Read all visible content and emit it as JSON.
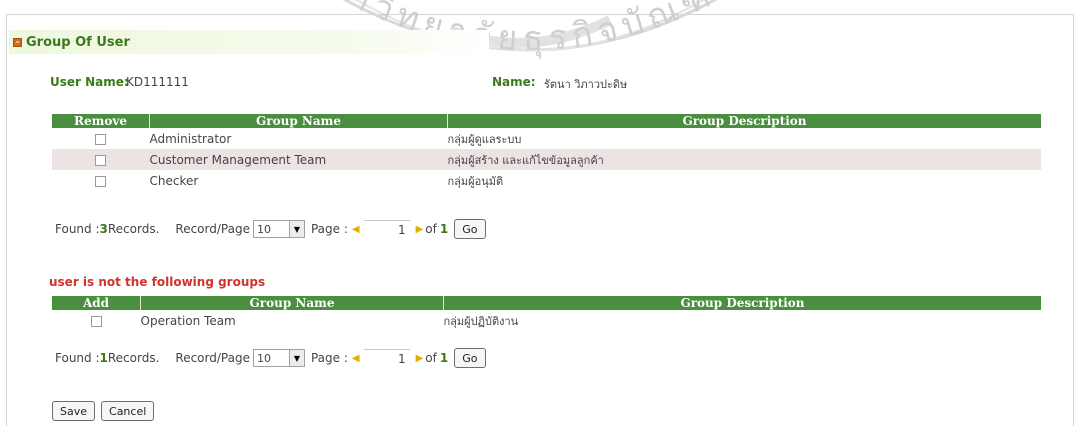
{
  "panel": {
    "title": "Group Of User",
    "toggle_glyph": "–"
  },
  "user": {
    "username_label": "User Name:",
    "username_value": "KD111111",
    "name_label": "Name:",
    "name_value": "รัตนา วิภาวปะดิษ"
  },
  "watermark": {
    "text": "มหาวิทยาลัยธุรกิจบัณฑิตย์"
  },
  "member_groups": {
    "columns": [
      "Remove",
      "Group Name",
      "Group Description"
    ],
    "rows": [
      {
        "name": "Administrator",
        "description": "กลุ่มผู้ดูแลระบบ"
      },
      {
        "name": "Customer Management Team",
        "description": "กลุ่มผู้สร้าง และแก้ไขข้อมูลลูกค้า"
      },
      {
        "name": "Checker",
        "description": "กลุ่มผู้อนุมัติ"
      }
    ],
    "pager": {
      "found_prefix": "Found : ",
      "count": "3",
      "found_suffix": " Records.",
      "record_label": "Record/Page",
      "record_value": "10",
      "page_label": "Page :",
      "page_value": "1",
      "of_label": "of",
      "total_pages": "1",
      "go_label": "Go"
    }
  },
  "nonmember_groups": {
    "title": "user is not the following groups",
    "columns": [
      "Add",
      "Group Name",
      "Group Description"
    ],
    "rows": [
      {
        "name": "Operation Team",
        "description": "กลุ่มผู้ปฏิบัติงาน"
      }
    ],
    "pager": {
      "found_prefix": "Found : ",
      "count": "1",
      "found_suffix": " Records.",
      "record_label": "Record/Page",
      "record_value": "10",
      "page_label": "Page :",
      "page_value": "1",
      "of_label": "of",
      "total_pages": "1",
      "go_label": "Go"
    }
  },
  "actions": {
    "save": "Save",
    "cancel": "Cancel"
  },
  "colors": {
    "header_green": "#4a8f3f",
    "label_green": "#3b7a18",
    "alert_red": "#d0342c",
    "row_alt": "#ede3e3"
  }
}
